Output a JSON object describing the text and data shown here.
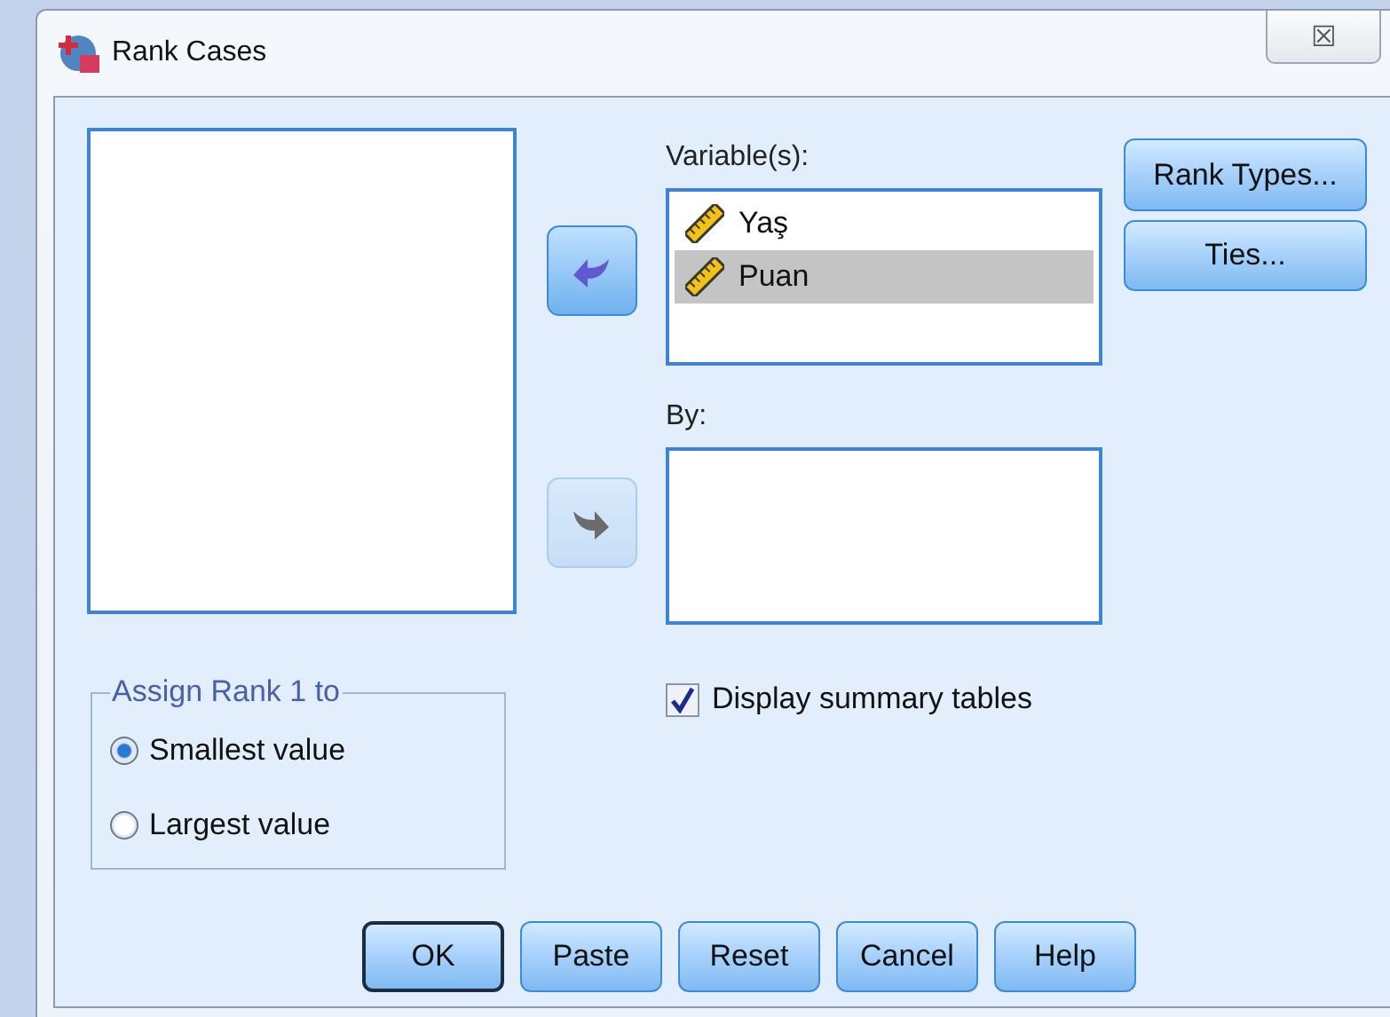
{
  "window": {
    "title": "Rank Cases",
    "close": "☒"
  },
  "move_buttons": [
    {
      "kind": "left",
      "disabled": false
    },
    {
      "kind": "right",
      "disabled": true
    }
  ],
  "variables": {
    "label": "Variable(s):",
    "items": [
      {
        "name": "Yaş",
        "selected": false
      },
      {
        "name": "Puan",
        "selected": true
      }
    ]
  },
  "by": {
    "label": "By:"
  },
  "side_buttons": [
    {
      "label": "Rank Types..."
    },
    {
      "label": "Ties..."
    }
  ],
  "assign_rank": {
    "legend": "Assign Rank 1 to",
    "options": [
      {
        "label": "Smallest value",
        "selected": true
      },
      {
        "label": "Largest value",
        "selected": false
      }
    ]
  },
  "summary": {
    "label": "Display summary tables",
    "checked": true
  },
  "buttons": [
    {
      "label": "OK",
      "default": true
    },
    {
      "label": "Paste",
      "default": false
    },
    {
      "label": "Reset",
      "default": false
    },
    {
      "label": "Cancel",
      "default": false
    },
    {
      "label": "Help",
      "default": false
    }
  ]
}
